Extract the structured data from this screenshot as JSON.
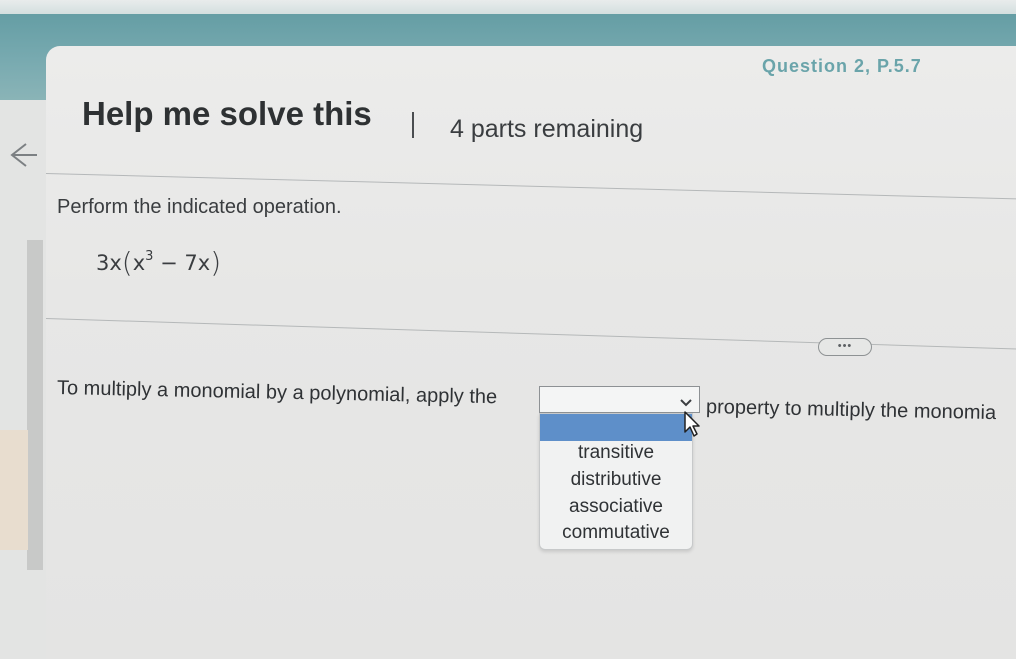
{
  "header": {
    "question_label": "Question 2, P.5.7",
    "title": "Help me solve this",
    "separator": "|",
    "parts_remaining": "4 parts remaining"
  },
  "problem": {
    "instruction": "Perform the indicated operation.",
    "expression": {
      "coefficient": "3x",
      "open_paren": "(",
      "base": "x",
      "exponent": "3",
      "rest": " − 7x",
      "close_paren": ")"
    }
  },
  "more_button": {
    "label": "•••"
  },
  "answer": {
    "prompt_before": "To multiply a monomial by a polynomial, apply the",
    "selected_value": "",
    "prompt_after": "property to multiply the monomia",
    "options": [
      "transitive",
      "distributive",
      "associative",
      "commutative"
    ],
    "highlighted_option": ""
  },
  "icons": {
    "back": "back-arrow-icon",
    "chevron": "chevron-down-icon",
    "cursor": "mouse-pointer-icon"
  },
  "colors": {
    "accent_teal": "#5f9aa1",
    "highlight_blue": "#5e8fc9",
    "text_dark": "#2f3235"
  }
}
